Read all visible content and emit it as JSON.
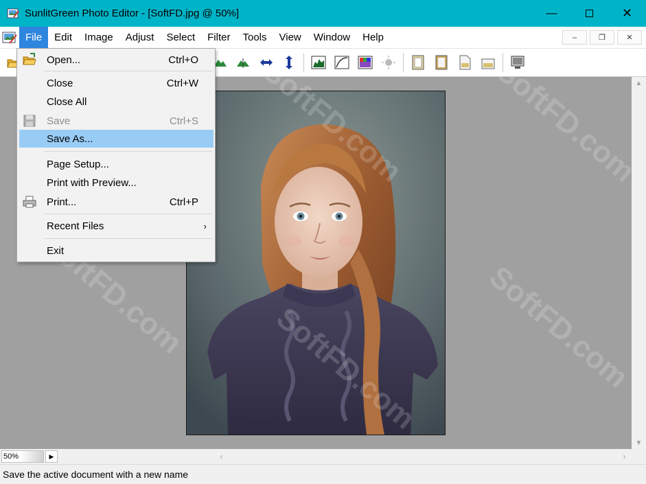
{
  "window": {
    "title": "SunlitGreen Photo Editor - [SoftFD.jpg @ 50%]",
    "controls": [
      "minimize-icon",
      "maximize-icon",
      "close-icon"
    ]
  },
  "menubar": {
    "items": [
      "File",
      "Edit",
      "Image",
      "Adjust",
      "Select",
      "Filter",
      "Tools",
      "View",
      "Window",
      "Help"
    ],
    "active": "File"
  },
  "file_menu": {
    "items": [
      {
        "label": "Open...",
        "shortcut": "Ctrl+O",
        "icon": "open-folder-icon"
      },
      {
        "label": "Close",
        "shortcut": "Ctrl+W"
      },
      {
        "label": "Close All",
        "shortcut": ""
      },
      {
        "label": "Save",
        "shortcut": "Ctrl+S",
        "icon": "save-disk-icon",
        "disabled": true
      },
      {
        "label": "Save As...",
        "shortcut": "",
        "selected": true
      },
      {
        "label": "Page Setup...",
        "shortcut": ""
      },
      {
        "label": "Print with Preview...",
        "shortcut": ""
      },
      {
        "label": "Print...",
        "shortcut": "Ctrl+P",
        "icon": "printer-icon"
      },
      {
        "label": "Recent Files",
        "shortcut": "",
        "submenu": true
      },
      {
        "label": "Exit",
        "shortcut": ""
      }
    ]
  },
  "watermark": "SoftFD.com",
  "zoom": {
    "value": "50%"
  },
  "status": {
    "text": "Save the active document with a new name"
  },
  "colors": {
    "titlebar": "#00b4c8",
    "menu_active": "#2e86de",
    "menu_selected": "#99ccf5",
    "workspace": "#a0a0a0"
  }
}
